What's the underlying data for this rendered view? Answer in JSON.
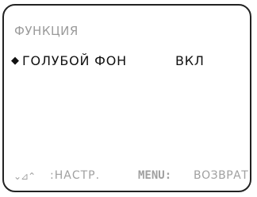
{
  "menu": {
    "title": "ФУНКЦИЯ",
    "items": [
      {
        "cursor": "◆",
        "label": "ГОЛУБОЙ ФОН",
        "value": "ВКЛ"
      }
    ]
  },
  "footer": {
    "nav_icons": "⌄⊿⌃",
    "setup_hint": ":НАСТР.",
    "menu_key": "MENU:",
    "back_hint": "ВОЗВРАТ"
  }
}
